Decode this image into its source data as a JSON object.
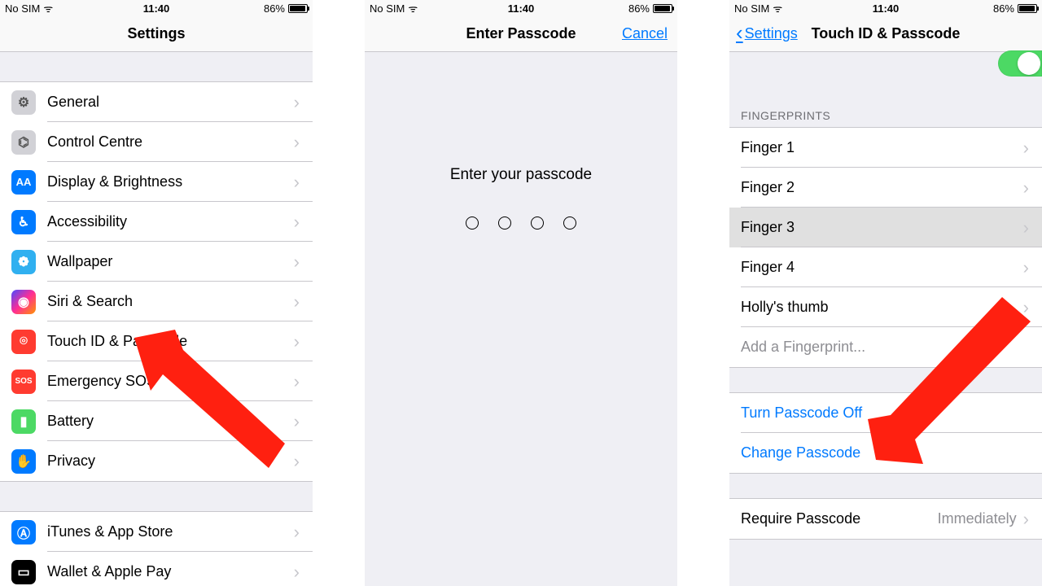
{
  "status": {
    "carrier": "No SIM",
    "time": "11:40",
    "battery": "86%"
  },
  "screen1": {
    "title": "Settings",
    "items": [
      {
        "label": "General"
      },
      {
        "label": "Control Centre"
      },
      {
        "label": "Display & Brightness"
      },
      {
        "label": "Accessibility"
      },
      {
        "label": "Wallpaper"
      },
      {
        "label": "Siri & Search"
      },
      {
        "label": "Touch ID & Passcode"
      },
      {
        "label": "Emergency SOS"
      },
      {
        "label": "Battery"
      },
      {
        "label": "Privacy"
      }
    ],
    "group2": [
      {
        "label": "iTunes & App Store"
      },
      {
        "label": "Wallet & Apple Pay"
      }
    ]
  },
  "screen2": {
    "title": "Enter Passcode",
    "cancel": "Cancel",
    "prompt": "Enter your passcode"
  },
  "screen3": {
    "back": "Settings",
    "title": "Touch ID & Passcode",
    "fingerprints_header": "FINGERPRINTS",
    "fingers": [
      {
        "label": "Finger 1"
      },
      {
        "label": "Finger 2"
      },
      {
        "label": "Finger 3"
      },
      {
        "label": "Finger 4"
      },
      {
        "label": "Holly's thumb"
      }
    ],
    "add_fingerprint": "Add a Fingerprint...",
    "turn_off": "Turn Passcode Off",
    "change": "Change Passcode",
    "require_label": "Require Passcode",
    "require_value": "Immediately"
  },
  "icons": {
    "general": "⚙︎",
    "control": "◉",
    "display": "AA",
    "accessibility": "➀",
    "wallpaper": "✿",
    "siri": "◐",
    "touchid": "◉",
    "sos": "SOS",
    "battery": "▭",
    "privacy": "✋",
    "itunes": "A",
    "wallet": "▭"
  }
}
